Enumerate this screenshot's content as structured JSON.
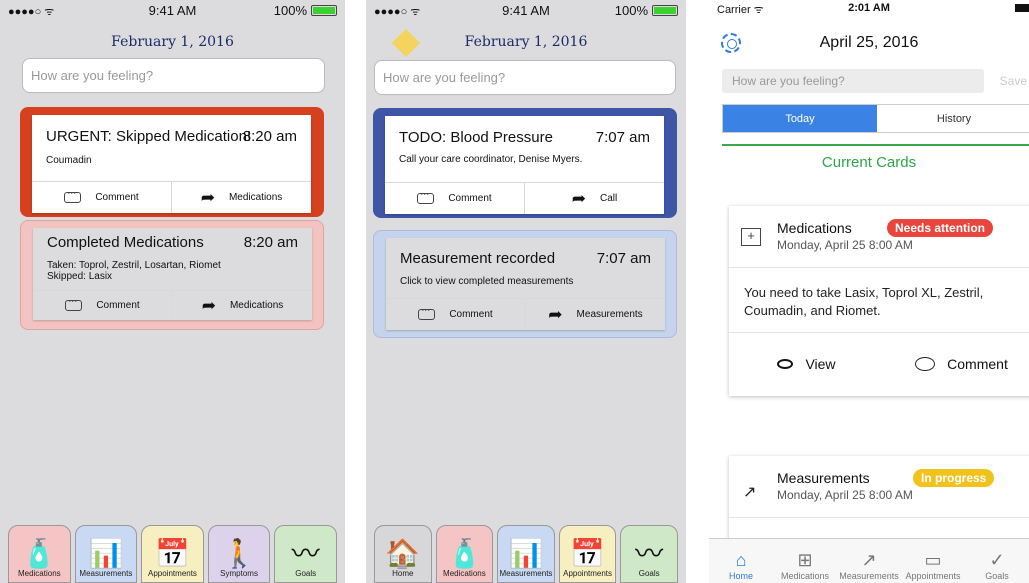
{
  "phone1": {
    "status": {
      "signal": "●●●●○ ᯤ",
      "time": "9:41 AM",
      "battery": "100%"
    },
    "date": "February 1, 2016",
    "feeling_placeholder": "How are you feeling?",
    "card_urgent": {
      "title": "URGENT: Skipped Medication!",
      "time": "8:20 am",
      "sub": "Coumadin",
      "action1": "Comment",
      "action2": "Medications",
      "color": "#d6401d"
    },
    "card_completed": {
      "title": "Completed Medications",
      "time": "8:20 am",
      "line1": "Taken:   Toprol, Zestril, Losartan, Riomet",
      "line2": "Skipped: Lasix",
      "action1": "Comment",
      "action2": "Medications",
      "color": "#f2c3c1"
    },
    "tabs": [
      {
        "label": "Medications",
        "icon": "pill-bottle-icon",
        "color": "#f5c4c4"
      },
      {
        "label": "Measurements",
        "icon": "bar-chart-icon",
        "color": "#c9d8f3"
      },
      {
        "label": "Appointments",
        "icon": "calendar-clock-icon",
        "color": "#f7efc0"
      },
      {
        "label": "Symptoms",
        "icon": "person-symptom-icon",
        "color": "#dcd2ec"
      },
      {
        "label": "Goals",
        "icon": "road-icon",
        "color": "#cfe8c8"
      }
    ]
  },
  "phone2": {
    "status": {
      "signal": "●●●●○ ᯤ",
      "time": "9:41 AM",
      "battery": "100%"
    },
    "date": "February 1, 2016",
    "feeling_placeholder": "How are you feeling?",
    "card_todo": {
      "title": "TODO: Blood Pressure",
      "time": "7:07 am",
      "sub": "Call your care coordinator, Denise Myers.",
      "action1": "Comment",
      "action2": "Call",
      "color": "#3f55a5"
    },
    "card_measure": {
      "title": "Measurement recorded",
      "time": "7:07 am",
      "sub": "Click to view completed measurements",
      "action1": "Comment",
      "action2": "Measurements",
      "color": "#c5d3ec"
    },
    "tabs": [
      {
        "label": "Home",
        "icon": "home-icon",
        "color": "#d7d7da"
      },
      {
        "label": "Medications",
        "icon": "pill-bottle-icon",
        "color": "#f5c4c4"
      },
      {
        "label": "Measurements",
        "icon": "bar-chart-icon",
        "color": "#c9d8f3"
      },
      {
        "label": "Appointments",
        "icon": "calendar-clock-icon",
        "color": "#f7efc0"
      },
      {
        "label": "Goals",
        "icon": "road-icon",
        "color": "#cfe8c8"
      }
    ]
  },
  "phone3": {
    "status": {
      "carrier": "Carrier ᯤ",
      "time": "2:01 AM"
    },
    "date": "April 25, 2016",
    "feeling_placeholder": "How are you feeling?",
    "save": "Save",
    "seg_today": "Today",
    "seg_history": "History",
    "current_cards": "Current Cards",
    "card_med": {
      "name": "Medications",
      "badge": "Needs attention",
      "date": "Monday, April 25 8:00 AM",
      "body": "You need to take Lasix, Toprol XL, Zestril, Coumadin, and Riomet.",
      "view": "View",
      "comment": "Comment"
    },
    "card_meas": {
      "name": "Measurements",
      "badge": "In progress",
      "date": "Monday, April 25 8:00 AM"
    },
    "tabs": [
      {
        "label": "Home",
        "icon": "home-icon"
      },
      {
        "label": "Medications",
        "icon": "medical-kit-icon"
      },
      {
        "label": "Measurements",
        "icon": "trend-icon"
      },
      {
        "label": "Appointments",
        "icon": "calendar-icon"
      },
      {
        "label": "Goals",
        "icon": "check-circle-icon"
      }
    ]
  }
}
